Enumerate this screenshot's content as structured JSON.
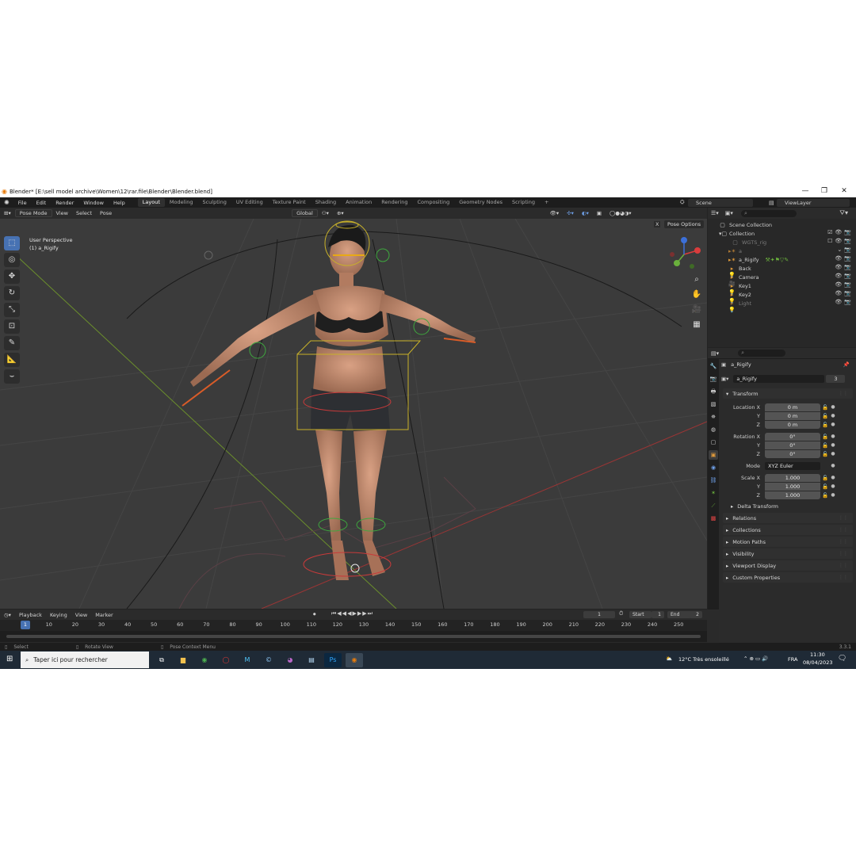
{
  "window": {
    "title": "Blender* [E:\\sell model archive\\Women\\12\\rar.file\\Blender\\Blender.blend]",
    "minimize": "—",
    "maximize": "❐",
    "close": "✕"
  },
  "menu": [
    "File",
    "Edit",
    "Render",
    "Window",
    "Help"
  ],
  "workspace_tabs": [
    "Layout",
    "Modeling",
    "Sculpting",
    "UV Editing",
    "Texture Paint",
    "Shading",
    "Animation",
    "Rendering",
    "Compositing",
    "Geometry Nodes",
    "Scripting"
  ],
  "active_tab": "Layout",
  "add_tab": "+",
  "scene": {
    "scene_name": "Scene",
    "view_layer": "ViewLayer"
  },
  "viewport": {
    "mode": "Pose Mode",
    "menus": [
      "View",
      "Select",
      "Pose"
    ],
    "orientation": "Global",
    "perspective": "User Perspective",
    "object_label": "(1) a_Rigify",
    "pose_options": "Pose Options",
    "x_label": "X",
    "gizmo_colors": {
      "x": "#d93c3c",
      "y": "#6ab03c",
      "z": "#3c70d9",
      "floor_x": "#9b3535",
      "floor_y": "#6b8f2c"
    }
  },
  "outliner": {
    "header": "Scene Collection",
    "items": [
      {
        "label": "Collection",
        "icon": "collection-icon",
        "level": 1,
        "dim": false
      },
      {
        "label": "WGTS_rig",
        "icon": "collection-icon",
        "level": 2,
        "dim": true
      },
      {
        "label": "a",
        "icon": "armature-icon",
        "level": 2,
        "dim": true
      },
      {
        "label": "a_Rigify",
        "icon": "armature-icon",
        "level": 2,
        "dim": false
      },
      {
        "label": "Back",
        "icon": "light-icon",
        "level": 2,
        "dim": false
      },
      {
        "label": "Camera",
        "icon": "camera-icon",
        "level": 2,
        "dim": false
      },
      {
        "label": "Key1",
        "icon": "light-icon",
        "level": 2,
        "dim": false
      },
      {
        "label": "Key2",
        "icon": "light-icon",
        "level": 2,
        "dim": false
      },
      {
        "label": "Light",
        "icon": "light-icon",
        "level": 2,
        "dim": true
      }
    ]
  },
  "properties": {
    "object_name": "a_Rigify",
    "data_name": "a_Rigify",
    "users": "3",
    "transform_label": "Transform",
    "location": {
      "label": "Location X",
      "x": "0 m",
      "y": "0 m",
      "z": "0 m"
    },
    "rotation": {
      "label": "Rotation X",
      "x": "0°",
      "y": "0°",
      "z": "0°"
    },
    "mode_label": "Mode",
    "mode_value": "XYZ Euler",
    "scale": {
      "label": "Scale X",
      "x": "1.000",
      "y": "1.000",
      "z": "1.000"
    },
    "axis_y": "Y",
    "axis_z": "Z",
    "subpanels": [
      "Delta Transform",
      "Relations",
      "Collections",
      "Motion Paths",
      "Visibility",
      "Viewport Display",
      "Custom Properties"
    ]
  },
  "timeline": {
    "menus": [
      "Playback",
      "Keying",
      "View",
      "Marker"
    ],
    "current_frame": "1",
    "start_label": "Start",
    "start": "1",
    "end_label": "End",
    "end": "2",
    "ticks": [
      "10",
      "20",
      "30",
      "40",
      "50",
      "60",
      "70",
      "80",
      "90",
      "100",
      "110",
      "120",
      "130",
      "140",
      "150",
      "160",
      "170",
      "180",
      "190",
      "200",
      "210",
      "220",
      "230",
      "240",
      "250"
    ]
  },
  "status": {
    "select": "Select",
    "rotate": "Rotate View",
    "context": "Pose Context Menu",
    "version": "3.3.1"
  },
  "taskbar": {
    "search_placeholder": "Taper ici pour rechercher",
    "weather": "12°C  Très ensoleillé",
    "lang": "FRA",
    "time": "11:30",
    "date": "08/04/2023"
  }
}
